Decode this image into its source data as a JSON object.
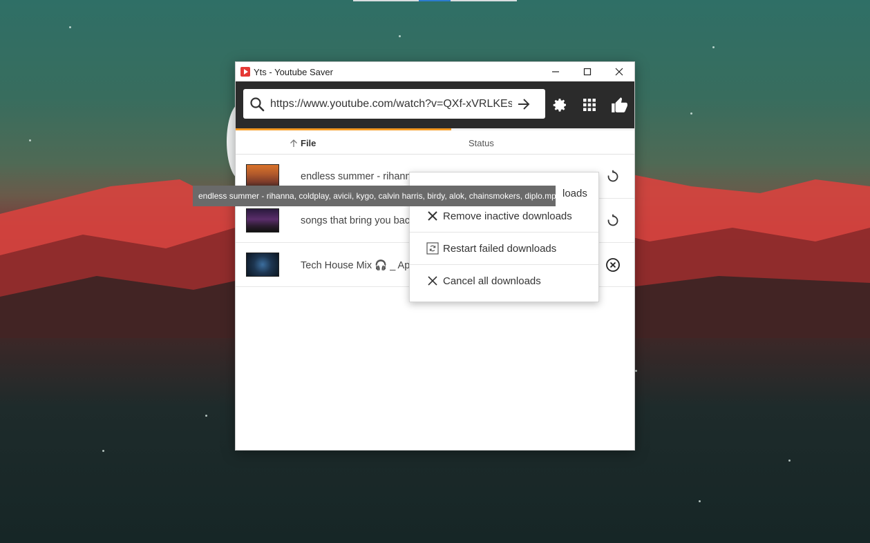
{
  "window": {
    "title": "Yts - Youtube Saver"
  },
  "toolbar": {
    "url_value": "https://www.youtube.com/watch?v=QXf-xVRLKEs",
    "search_icon": "search-icon",
    "go_icon": "arrow-right-icon",
    "settings_icon": "gear-icon",
    "apps_icon": "grid-icon",
    "like_icon": "thumbs-up-icon",
    "progress": 0.54
  },
  "table": {
    "col_file": "File",
    "col_status": "Status",
    "rows": [
      {
        "title": "endless summer - rihanna",
        "action_icon": "retry-icon"
      },
      {
        "title": "songs that bring you back",
        "action_icon": "retry-icon"
      },
      {
        "title": "Tech House Mix 🎧 _ Apri",
        "action_icon": "cancel-circle-icon"
      }
    ]
  },
  "context_menu": {
    "items": [
      {
        "label": "Remove inactive downloads",
        "icon": "close-icon"
      },
      {
        "label": "Restart failed downloads",
        "icon": "restart-icon"
      },
      {
        "label": "Cancel all downloads",
        "icon": "close-icon"
      }
    ],
    "partial_text": "loads"
  },
  "tooltip": {
    "text": "endless summer - rihanna, coldplay, avicii, kygo, calvin harris, birdy, alok, chainsmokers, diplo.mp3"
  },
  "colors": {
    "accent_progress": "#f59a23",
    "toolbar_bg": "#2b2b2b",
    "tooltip_bg": "#6a6a6a"
  }
}
